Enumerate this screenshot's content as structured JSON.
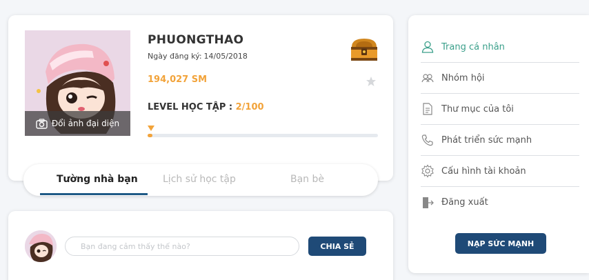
{
  "profile": {
    "avatar_action_label": "Đổi ảnh đại diện",
    "username": "PHUONGTHAO",
    "registration_label": "Ngày đăng ký:",
    "registration_date": "14/05/2018",
    "power_points": "194,027 SM",
    "level_label": "LEVEL HỌC TẬP :",
    "level_value": "2/100",
    "level_progress_fraction": 0.02,
    "accent_color": "#f2a33a"
  },
  "tabs": [
    {
      "label": "Tường nhà bạn",
      "active": true
    },
    {
      "label": "Lịch sử học tập",
      "active": false
    },
    {
      "label": "Bạn bè",
      "active": false
    }
  ],
  "post": {
    "placeholder": "Bạn đang cảm thấy thế nào?",
    "share_label": "CHIA SẺ"
  },
  "menu": {
    "items": [
      {
        "label": "Trang cá nhân",
        "icon": "user-icon",
        "active": true
      },
      {
        "label": "Nhóm hội",
        "icon": "group-icon",
        "active": false
      },
      {
        "label": "Thư mục của tôi",
        "icon": "document-icon",
        "active": false
      },
      {
        "label": "Phát triển sức mạnh",
        "icon": "phone-icon",
        "active": false
      },
      {
        "label": "Cấu hình tài khoản",
        "icon": "gear-icon",
        "active": false
      },
      {
        "label": "Đăng xuất",
        "icon": "logout-icon",
        "active": false
      }
    ],
    "power_button_label": "NẠP SỨC MẠNH"
  },
  "colors": {
    "primary_button": "#1f4a77",
    "active_menu": "#3a9f8a",
    "tab_underline": "#1f5a86"
  }
}
